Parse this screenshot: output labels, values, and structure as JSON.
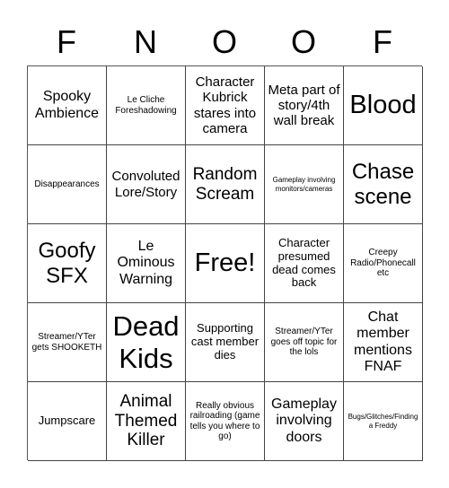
{
  "header": {
    "letters": [
      "F",
      "N",
      "O",
      "O",
      "F"
    ]
  },
  "board": {
    "rows": [
      [
        "Spooky Ambience",
        "Le Cliche Foreshadowing",
        "Character Kubrick stares into camera",
        "Meta part of story/4th wall break",
        "Blood"
      ],
      [
        "Disappearances",
        "Convoluted Lore/Story",
        "Random Scream",
        "Gameplay involving monitors/cameras",
        "Chase scene"
      ],
      [
        "Goofy SFX",
        "Le Ominous Warning",
        "Free!",
        "Character presumed dead comes back",
        "Creepy Radio/Phonecall etc"
      ],
      [
        "Streamer/YTer gets SHOOKETH",
        "Dead Kids",
        "Supporting cast member dies",
        "Streamer/YTer goes off topic for the lols",
        "Chat member mentions FNAF"
      ],
      [
        "Jumpscare",
        "Animal Themed Killer",
        "Really obvious railroading (game tells you where to go)",
        "Gameplay involving doors",
        "Bugs/Glitches/Finding a Freddy"
      ]
    ]
  }
}
